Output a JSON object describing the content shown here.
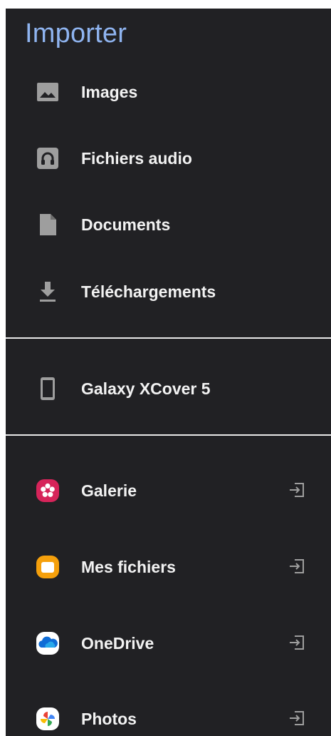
{
  "drawer": {
    "title": "Importer",
    "local": [
      {
        "label": "Images",
        "icon": "image-icon"
      },
      {
        "label": "Fichiers audio",
        "icon": "audio-icon"
      },
      {
        "label": "Documents",
        "icon": "document-icon"
      },
      {
        "label": "Téléchargements",
        "icon": "download-icon"
      }
    ],
    "devices": [
      {
        "label": "Galaxy XCover 5",
        "icon": "phone-icon"
      }
    ],
    "apps": [
      {
        "label": "Galerie",
        "icon": "galerie-app-icon",
        "color": "#d6245a"
      },
      {
        "label": "Mes fichiers",
        "icon": "my-files-app-icon",
        "color": "#f5a00c"
      },
      {
        "label": "OneDrive",
        "icon": "onedrive-app-icon",
        "color": "#ffffff"
      },
      {
        "label": "Photos",
        "icon": "google-photos-app-icon",
        "color": "#ffffff"
      }
    ],
    "colors": {
      "background": "#212124",
      "title": "#8fb4f0",
      "icon_gray": "#9e9e9e"
    }
  }
}
